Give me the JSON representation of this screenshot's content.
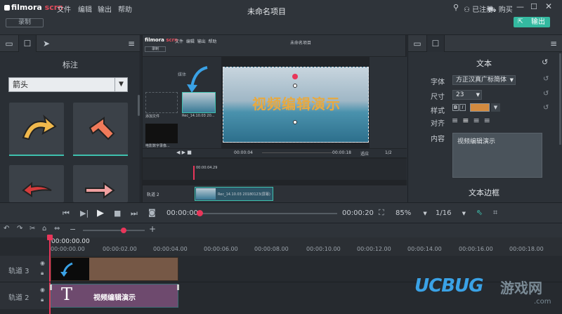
{
  "app": {
    "logo_main": "filmora",
    "logo_sub": "scrn",
    "title": "未命名项目"
  },
  "menu": [
    "文件",
    "编辑",
    "输出",
    "帮助"
  ],
  "header": {
    "registered": "已注册",
    "buy": "购买",
    "export": "输出",
    "record": "录制"
  },
  "left_panel": {
    "section_title": "标注",
    "dropdown_value": "箭头"
  },
  "preview": {
    "inner_title": "未命名项目",
    "video_caption": "视频编辑演示",
    "inner_record": "录制",
    "media_add": "添加文件",
    "media_clip1": "Rec_14.10.03 20...",
    "media_clip2": "电影数字录像...",
    "inner_time": "00:00:04",
    "inner_time2": "00:00:18",
    "inner_fit": "适应",
    "inner_page": "1/2",
    "inner_ruler_time": "00:00:04.29",
    "inner_track": "轨道 2",
    "inner_clip": "Rec_14.10.03 20180123(屏幕)",
    "inner_media_tab": "媒体"
  },
  "right_panel": {
    "title": "文本",
    "font_label": "字体",
    "font_value": "方正汉真广标简体",
    "size_label": "尺寸",
    "size_value": "23",
    "style_label": "样式",
    "style_bold": "B",
    "style_italic": "I",
    "text_color": "#d28a3f",
    "align_label": "对齐",
    "content_label": "内容",
    "content_value": "视频编辑演示",
    "border_title": "文本边框"
  },
  "player": {
    "current_time": "00:00:00",
    "total_time": "00:00:20",
    "zoom": "85%",
    "page": "1/16"
  },
  "timeline": {
    "playhead": "00:00:00.00",
    "ticks": [
      "00:00:00.00",
      "00:00:02.00",
      "00:00:04.00",
      "00:00:06.00",
      "00:00:08.00",
      "00:00:10.00",
      "00:00:12.00",
      "00:00:14.00",
      "00:00:16.00",
      "00:00:18.00"
    ],
    "track3": "轨道 3",
    "track2": "轨道 2",
    "text_clip_label": "视频编辑演示"
  },
  "watermark": {
    "main": "UCBUG",
    "cn": "游戏网",
    "dotcom": ".com"
  }
}
